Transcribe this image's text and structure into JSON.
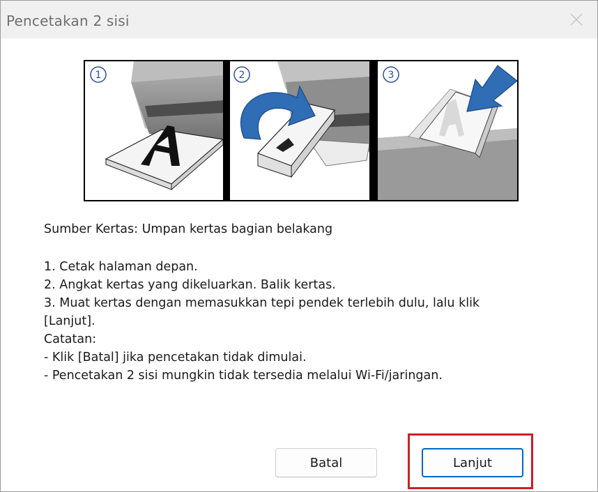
{
  "window": {
    "title": "Pencetakan 2 sisi"
  },
  "illustration": {
    "steps": [
      "1",
      "2",
      "3"
    ]
  },
  "content": {
    "paper_source": "Sumber Kertas: Umpan kertas bagian belakang",
    "lines": [
      "1. Cetak halaman depan.",
      "2. Angkat kertas yang dikeluarkan. Balik kertas.",
      "3. Muat kertas dengan memasukkan tepi pendek terlebih dulu, lalu klik",
      "[Lanjut].",
      "Catatan:",
      "- Klik [Batal] jika pencetakan tidak dimulai.",
      "- Pencetakan 2 sisi mungkin tidak tersedia melalui Wi-Fi/jaringan."
    ]
  },
  "buttons": {
    "cancel_label": "Batal",
    "next_label": "Lanjut"
  },
  "icons": {
    "close": "close-icon",
    "arrow": "blue-arrow-icon"
  },
  "colors": {
    "primary_border": "#0067c0",
    "highlight": "#cc1f2a",
    "arrow_blue": "#2f6db5"
  }
}
